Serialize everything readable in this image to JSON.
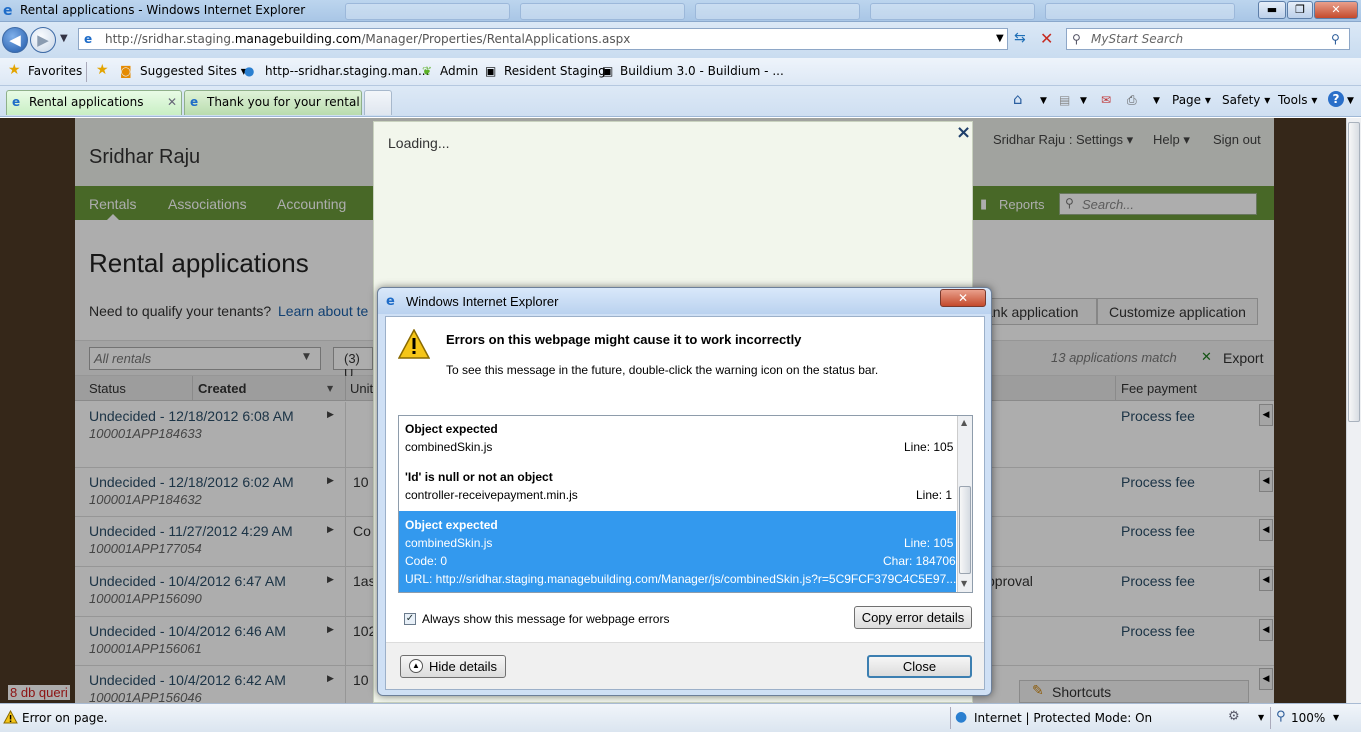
{
  "window": {
    "title": "Rental applications - Windows Internet Explorer",
    "controls": {
      "minimize": "▬",
      "maximize": "❐",
      "close": "✕"
    }
  },
  "address": {
    "url_prefix": "http://sridhar.staging.",
    "url_domain": "managebuilding.com",
    "url_path": "/Manager/Properties/RentalApplications.aspx",
    "search_placeholder": "MyStart Search"
  },
  "favorites": {
    "favorites_label": "Favorites",
    "items": [
      "Suggested Sites ▾",
      "http--sridhar.staging.man...",
      "Admin",
      "Resident Staging",
      "Buildium 3.0 - Buildium - ..."
    ]
  },
  "tabs": [
    {
      "label": "Rental applications"
    },
    {
      "label": "Thank you for your rental ..."
    }
  ],
  "command_bar": {
    "page": "Page ▾",
    "safety": "Safety ▾",
    "tools": "Tools ▾",
    "help": "?"
  },
  "app": {
    "user_name": "Sridhar Raju",
    "top_right_user": "Sridhar Raju :",
    "settings": "Settings ▾",
    "help": "Help ▾",
    "signout": "Sign out",
    "nav": [
      "Rentals",
      "Associations",
      "Accounting"
    ],
    "reports": "Reports",
    "search_placeholder": "Search...",
    "page_title": "Rental applications",
    "qualify_text": "Need to qualify your tenants?",
    "qualify_link": "Learn about te",
    "blank_app": "ank application",
    "customize_app": "Customize application",
    "filter_value": "All rentals",
    "filter2": "(3) U",
    "match_count": "13 applications match",
    "export": "Export",
    "columns": {
      "status": "Status",
      "created": "Created",
      "unit": "Unit",
      "fee": "Fee payment"
    },
    "rows": [
      {
        "status": "Undecided - 12/18/2012 6:08 AM",
        "id": "100001APP184633",
        "unit": "",
        "extra": "",
        "fee": "Process fee"
      },
      {
        "status": "Undecided - 12/18/2012 6:02 AM",
        "id": "100001APP184632",
        "unit": "10",
        "extra": "",
        "fee": "Process fee"
      },
      {
        "status": "Undecided - 11/27/2012 4:29 AM",
        "id": "100001APP177054",
        "unit": "Co",
        "extra": "",
        "fee": "Process fee"
      },
      {
        "status": "Undecided - 10/4/2012 6:47 AM",
        "id": "100001APP156090",
        "unit": "1as",
        "extra": "pproval",
        "fee": "Process fee"
      },
      {
        "status": "Undecided - 10/4/2012 6:46 AM",
        "id": "100001APP156061",
        "unit": "102",
        "extra": "",
        "fee": "Process fee"
      },
      {
        "status": "Undecided - 10/4/2012 6:42 AM",
        "id": "100001APP156046",
        "unit": "10",
        "extra": "",
        "fee": "Process fee"
      }
    ],
    "db_queries": "8 db queri",
    "shortcuts": "Shortcuts"
  },
  "loading": {
    "text": "Loading...",
    "close": "×"
  },
  "dialog": {
    "title": "Windows Internet Explorer",
    "heading": "Errors on this webpage might cause it to work incorrectly",
    "subtext": "To see this message in the future, double-click the warning icon on the status bar.",
    "errors": [
      {
        "title": "Object expected",
        "file": "combinedSkin.js",
        "line": "Line: 105"
      },
      {
        "title": "'Id' is null or not an object",
        "file": "controller-receivepayment.min.js",
        "line": "Line: 1"
      },
      {
        "title": "Object expected",
        "file": "combinedSkin.js",
        "line": "Line: 105",
        "code": "Code: 0",
        "char": "Char: 184706",
        "url": "URL: http://sridhar.staging.managebuilding.com/Manager/js/combinedSkin.js?r=5C9FCF379C4C5E97..."
      }
    ],
    "always_show": "Always show this message for webpage errors",
    "copy_details": "Copy error details",
    "hide_details": "Hide details",
    "close": "Close"
  },
  "status": {
    "error_text": "Error on page.",
    "zone": "Internet | Protected Mode: On",
    "zoom": "100%"
  },
  "colors": {
    "nav_green": "#6a9a3a",
    "accent_blue": "#3399ee",
    "link_blue": "#1a5fa8"
  }
}
